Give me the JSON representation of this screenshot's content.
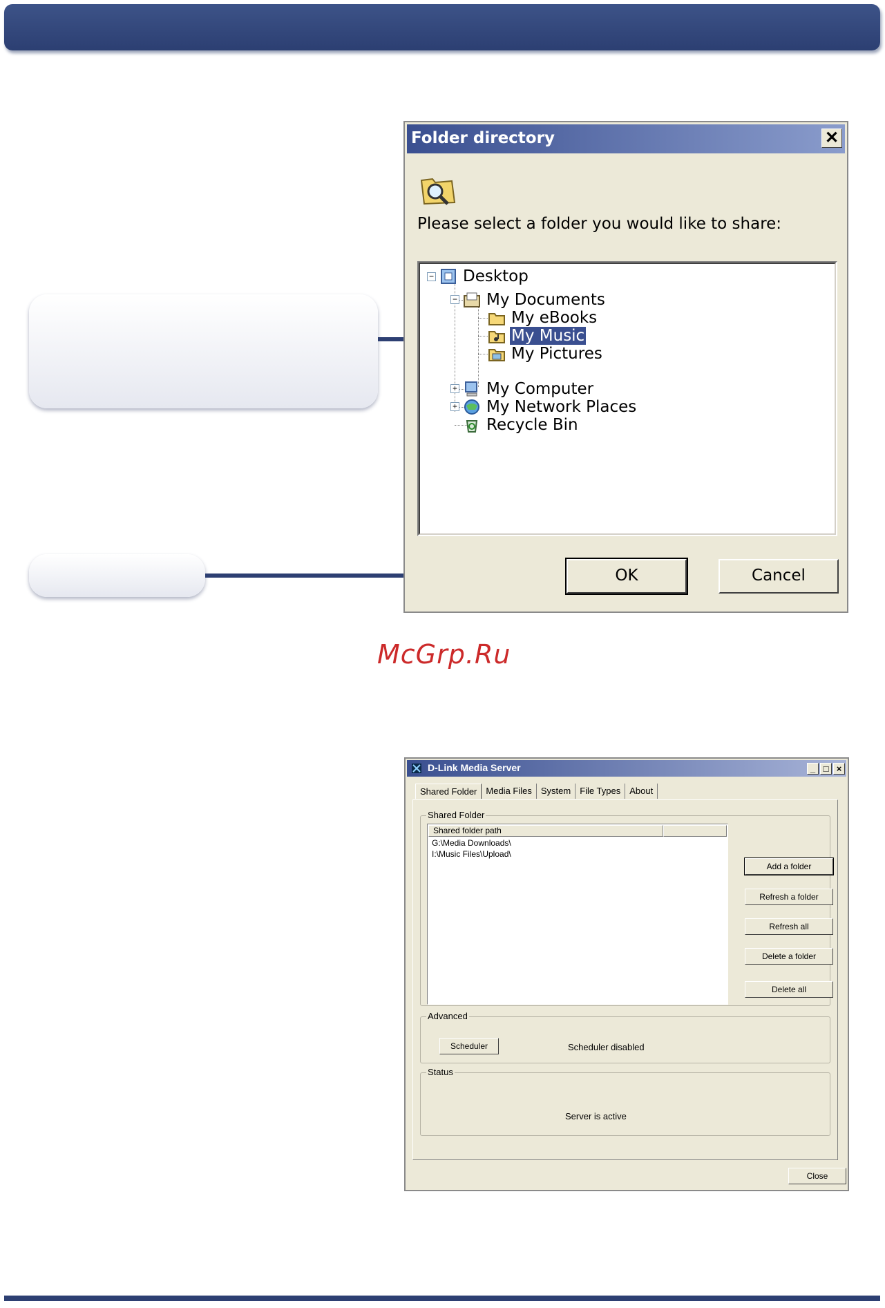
{
  "dialog": {
    "title": "Folder directory",
    "close_glyph": "✕",
    "prompt": "Please select a folder you would like to share:",
    "tree": [
      {
        "label": "Desktop",
        "icon": "desktop-icon",
        "expander": "−"
      },
      {
        "label": "My Documents",
        "icon": "my-documents-icon",
        "expander": "−"
      },
      {
        "label": "My eBooks",
        "icon": "folder-icon"
      },
      {
        "label": "My Music",
        "icon": "music-folder-icon",
        "selected": true
      },
      {
        "label": "My Pictures",
        "icon": "pictures-folder-icon"
      },
      {
        "label": "My Computer",
        "icon": "my-computer-icon",
        "expander": "+"
      },
      {
        "label": "My Network Places",
        "icon": "network-places-icon",
        "expander": "+"
      },
      {
        "label": "Recycle Bin",
        "icon": "recycle-bin-icon"
      }
    ],
    "ok_label": "OK",
    "cancel_label": "Cancel"
  },
  "watermark": "McGrp.Ru",
  "media_server": {
    "title": "D-Link Media Server",
    "window_controls": [
      "_",
      "□",
      "×"
    ],
    "tabs": [
      "Shared Folder",
      "Media Files",
      "System",
      "File Types",
      "About"
    ],
    "active_tab": "Shared Folder",
    "shared_folder_group": "Shared Folder",
    "list_header": "Shared folder path",
    "paths": [
      "G:\\Media Downloads\\",
      "I:\\Music Files\\Upload\\"
    ],
    "buttons": [
      "Add a folder",
      "Refresh a folder",
      "Refresh all",
      "Delete a folder",
      "Delete all"
    ],
    "advanced_group": "Advanced",
    "scheduler_button": "Scheduler",
    "scheduler_status": "Scheduler disabled",
    "status_group": "Status",
    "server_status": "Server is active",
    "close_button": "Close"
  },
  "colors": {
    "accent_navy": "#2d3f72",
    "titlebar_start": "#3a4f90",
    "dialog_bg": "#ece9d8",
    "watermark_red": "#cc2a2a"
  }
}
